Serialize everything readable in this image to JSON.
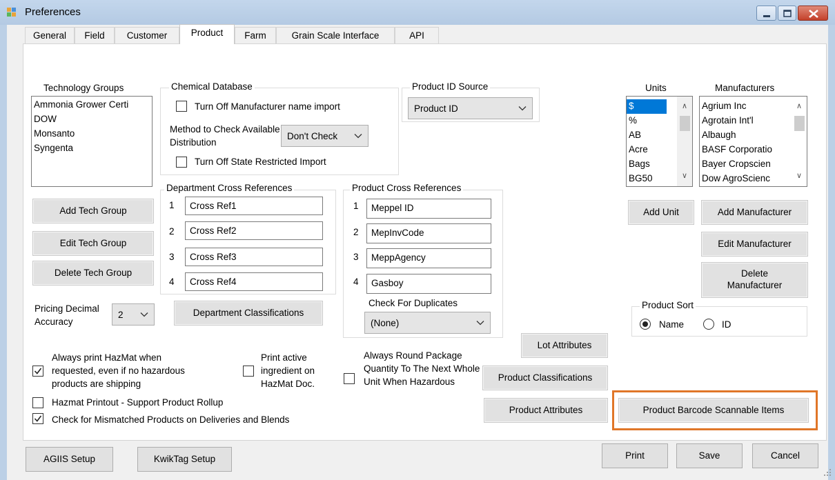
{
  "window": {
    "title": "Preferences"
  },
  "tabs": [
    "General",
    "Field",
    "Customer",
    "Product",
    "Farm",
    "Grain Scale Interface",
    "API"
  ],
  "technology_groups": {
    "label": "Technology Groups",
    "items": [
      "Ammonia Grower Certi",
      "DOW",
      "Monsanto",
      "Syngenta"
    ],
    "buttons": {
      "add": "Add Tech Group",
      "edit": "Edit Tech Group",
      "delete": "Delete Tech Group"
    }
  },
  "chemical_database": {
    "label": "Chemical Database",
    "turn_off_manufacturer_name_import": "Turn Off Manufacturer name import",
    "method_label": "Method to Check Available Distribution",
    "method_value": "Don't Check",
    "turn_off_state_restricted_import": "Turn Off State Restricted Import"
  },
  "product_id_source": {
    "label": "Product ID Source",
    "value": "Product ID"
  },
  "units": {
    "label": "Units",
    "items": [
      "$",
      "%",
      "AB",
      "Acre",
      "Bags",
      "BG50"
    ],
    "selected": "$",
    "add_button": "Add Unit"
  },
  "manufacturers": {
    "label": "Manufacturers",
    "items": [
      "Agrium Inc",
      "Agrotain Int'l",
      "Albaugh",
      "BASF Corporatio",
      "Bayer Cropscien",
      "Dow AgroScienc"
    ],
    "buttons": {
      "add": "Add Manufacturer",
      "edit": "Edit Manufacturer",
      "delete": "Delete Manufacturer"
    }
  },
  "department_cross_references": {
    "label": "Department Cross References",
    "rows": [
      {
        "n": "1",
        "value": "Cross Ref1"
      },
      {
        "n": "2",
        "value": "Cross Ref2"
      },
      {
        "n": "3",
        "value": "Cross Ref3"
      },
      {
        "n": "4",
        "value": "Cross Ref4"
      }
    ],
    "classifications_button": "Department Classifications"
  },
  "product_cross_references": {
    "label": "Product Cross References",
    "rows": [
      {
        "n": "1",
        "value": "Meppel ID"
      },
      {
        "n": "2",
        "value": "MepInvCode"
      },
      {
        "n": "3",
        "value": "MeppAgency"
      },
      {
        "n": "4",
        "value": "Gasboy"
      }
    ],
    "check_duplicates_label": "Check For Duplicates",
    "check_duplicates_value": "(None)"
  },
  "pricing_decimal": {
    "label": "Pricing Decimal Accuracy",
    "value": "2"
  },
  "product_sort": {
    "label": "Product Sort",
    "name": "Name",
    "id": "ID",
    "selected": "Name"
  },
  "options": {
    "always_print_hazmat": "Always print HazMat when requested, even if no hazardous products are shipping",
    "print_active_ingredient": "Print active ingredient on HazMat Doc.",
    "always_round_package": "Always Round Package Quantity To The Next Whole Unit When Hazardous",
    "hazmat_printout_rollup": "Hazmat Printout - Support Product Rollup",
    "check_mismatched": "Check for Mismatched Products on Deliveries and Blends"
  },
  "buttons": {
    "lot_attributes": "Lot Attributes",
    "product_classifications": "Product Classifications",
    "product_attributes": "Product Attributes",
    "product_barcode_scannable": "Product Barcode Scannable Items",
    "agiis_setup": "AGIIS Setup",
    "kwiktag_setup": "KwikTag Setup",
    "print": "Print",
    "save": "Save",
    "cancel": "Cancel"
  },
  "colors": {
    "highlight": "#e07628",
    "selection": "#0078d7"
  }
}
